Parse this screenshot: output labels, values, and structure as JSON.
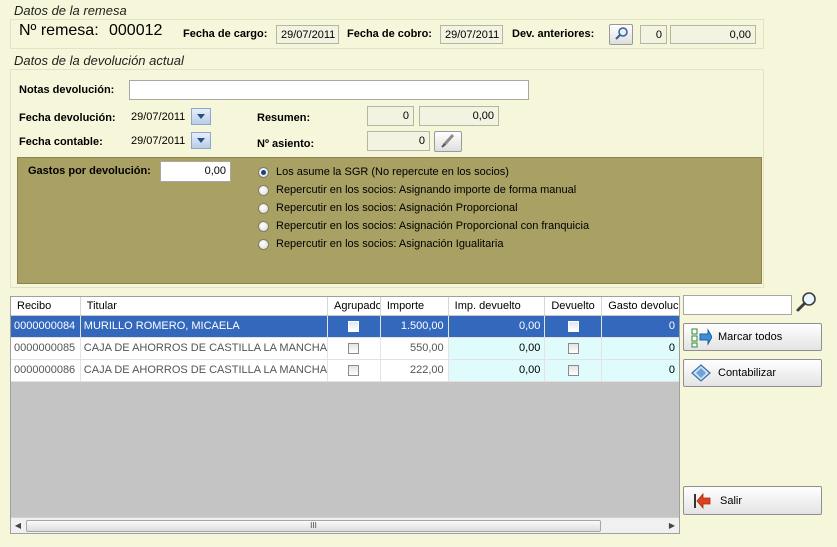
{
  "remesa_section": {
    "title": "Datos de la remesa",
    "remesa_label": "Nº remesa:",
    "remesa_value": "000012",
    "fecha_cargo_label": "Fecha de cargo:",
    "fecha_cargo_value": "29/07/2011",
    "fecha_cobro_label": "Fecha de cobro:",
    "fecha_cobro_value": "29/07/2011",
    "dev_anteriores_label": "Dev. anteriores:",
    "dev_count": "0",
    "dev_amount": "0,00"
  },
  "devolucion_section": {
    "title": "Datos de la devolución actual",
    "notas_label": "Notas devolución:",
    "notas_value": "",
    "fecha_devolucion_label": "Fecha devolución:",
    "fecha_devolucion_value": "29/07/2011",
    "fecha_contable_label": "Fecha contable:",
    "fecha_contable_value": "29/07/2011",
    "resumen_label": "Resumen:",
    "resumen_count": "0",
    "resumen_amount": "0,00",
    "asiento_label": "Nº asiento:",
    "asiento_value": "0"
  },
  "gastos": {
    "label": "Gastos por devolución:",
    "value": "0,00",
    "options": [
      "Los asume la SGR (No repercute en los socios)",
      "Repercutir en los socios: Asignando importe de forma manual",
      "Repercutir en los socios: Asignación Proporcional",
      "Repercutir en los socios: Asignación Proporcional con franquicia",
      "Repercutir en los socios: Asignación Igualitaria"
    ],
    "selected_index": 0
  },
  "grid": {
    "columns": [
      "Recibo",
      "Titular",
      "Agrupado",
      "Importe",
      "Imp. devuelto",
      "Devuelto",
      "Gasto devoluci"
    ],
    "rows": [
      {
        "recibo": "0000000084",
        "titular": "MURILLO ROMERO, MICAELA",
        "agrupado": false,
        "importe": "1.500,00",
        "imp_devuelto": "0,00",
        "devuelto": false,
        "gasto": "0"
      },
      {
        "recibo": "0000000085",
        "titular": "CAJA DE AHORROS DE CASTILLA LA MANCHA",
        "agrupado": false,
        "importe": "550,00",
        "imp_devuelto": "0,00",
        "devuelto": false,
        "gasto": "0"
      },
      {
        "recibo": "0000000086",
        "titular": "CAJA DE AHORROS DE CASTILLA LA MANCHA",
        "agrupado": false,
        "importe": "222,00",
        "imp_devuelto": "0,00",
        "devuelto": false,
        "gasto": "0"
      }
    ],
    "selected_row": 0,
    "scroll_thumb_glyph": "III"
  },
  "side": {
    "search_value": "",
    "marcar_todos_label": "Marcar todos",
    "contabilizar_label": "Contabilizar",
    "salir_label": "Salir"
  }
}
